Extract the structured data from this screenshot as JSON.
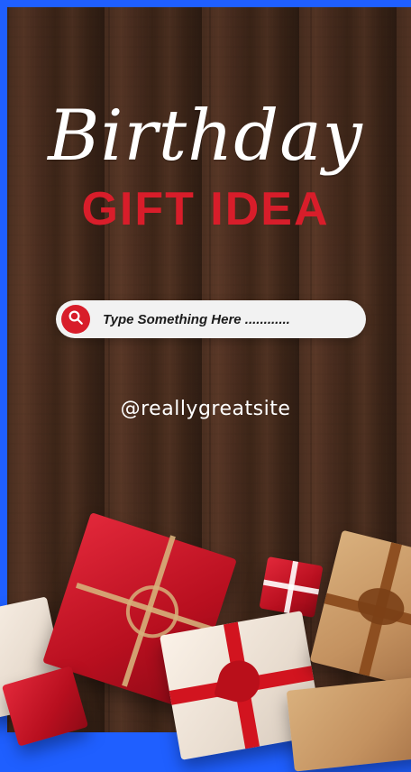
{
  "heading": {
    "script": "Birthday",
    "main": "GIFT IDEA"
  },
  "search": {
    "placeholder": "Type Something Here ............",
    "icon": "search-icon"
  },
  "footer": {
    "handle": "@reallygreatsite"
  },
  "colors": {
    "accent": "#d81d2a",
    "frame": "#1f5fff",
    "text": "#ffffff"
  }
}
